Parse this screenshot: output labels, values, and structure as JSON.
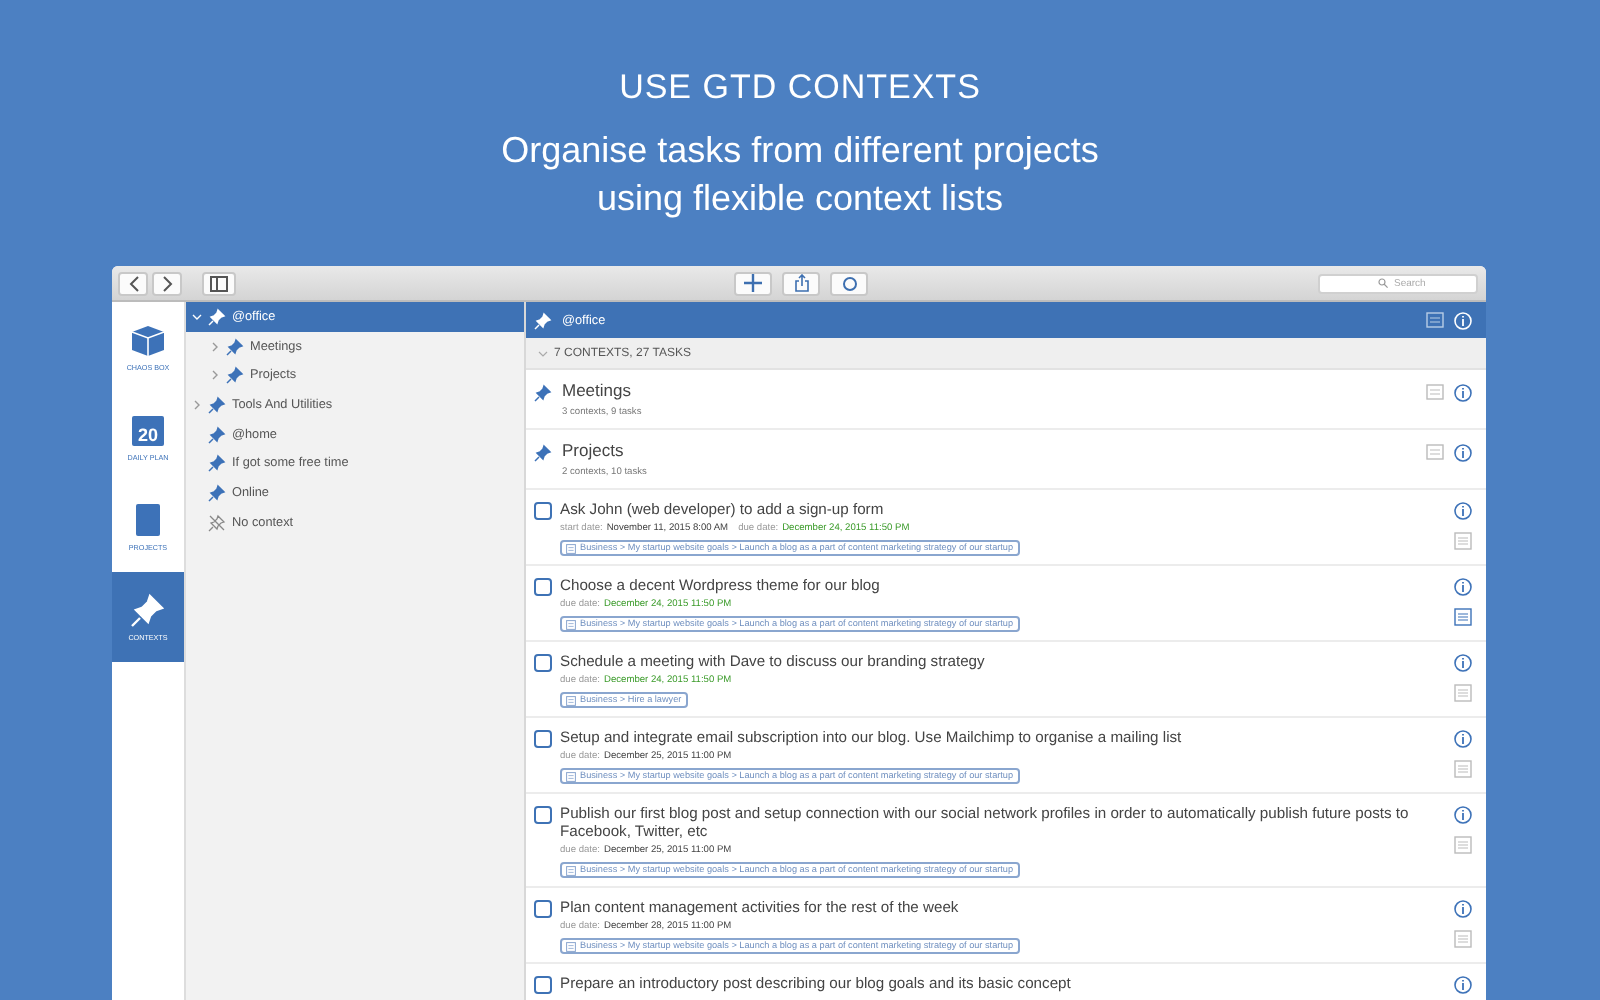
{
  "hero": {
    "title": "USE GTD CONTEXTS",
    "subtitle_lines": [
      "Organise tasks from different projects",
      "using flexible context lists"
    ]
  },
  "toolbar": {
    "search": {
      "placeholder": "Search"
    }
  },
  "nav": [
    {
      "label": "CHAOS BOX",
      "selected": false
    },
    {
      "label": "DAILY PLAN",
      "day": "20",
      "selected": false
    },
    {
      "label": "PROJECTS",
      "selected": false
    },
    {
      "label": "CONTEXTS",
      "selected": true
    }
  ],
  "tree": [
    {
      "label": "@office",
      "kind": "pin",
      "expanded": true,
      "selected": true,
      "children": [
        {
          "label": "Meetings",
          "kind": "pin",
          "expanded": false,
          "selected": false
        },
        {
          "label": "Projects",
          "kind": "pin",
          "expanded": false,
          "selected": false
        }
      ]
    },
    {
      "label": "Tools And Utilities",
      "kind": "pin",
      "expanded": false,
      "selected": false
    },
    {
      "label": "@home",
      "kind": "pin",
      "selected": false
    },
    {
      "label": "If got some free time",
      "kind": "pin",
      "selected": false
    },
    {
      "label": "Online",
      "kind": "pin",
      "selected": false
    },
    {
      "label": "No context",
      "kind": "none",
      "selected": false
    }
  ],
  "main": {
    "header": "@office",
    "group": "7 CONTEXTS, 27 TASKS",
    "contexts": [
      {
        "name": "Meetings",
        "summary": "3 contexts, 9 tasks"
      },
      {
        "name": "Projects",
        "summary": "2 contexts, 10 tasks"
      }
    ],
    "tasks": [
      {
        "title": "Ask John (web developer) to add a sign-up form",
        "checked": false,
        "start_label": "start date:",
        "start": "November 11, 2015 8:00 AM",
        "due_label": "due date:",
        "due": "December 24, 2015 11:50 PM",
        "due_soon": true,
        "project": "Business > My startup website goals > Launch a blog as a part of content marketing strategy of our startup",
        "note_active": false
      },
      {
        "title": "Choose a decent Wordpress theme for our blog",
        "checked": false,
        "due_label": "due date:",
        "due": "December 24, 2015 11:50 PM",
        "due_soon": true,
        "project": "Business > My startup website goals > Launch a blog as a part of content marketing strategy of our startup",
        "note_active": true
      },
      {
        "title": "Schedule a meeting with Dave to discuss our branding strategy",
        "checked": false,
        "due_label": "due date:",
        "due": "December 24, 2015 11:50 PM",
        "due_soon": true,
        "project": "Business > Hire a lawyer",
        "note_active": false
      },
      {
        "title": "Setup and integrate email subscription into our blog. Use Mailchimp to organise a mailing list",
        "checked": false,
        "due_label": "due date:",
        "due": "December 25, 2015 11:00 PM",
        "due_soon": false,
        "project": "Business > My startup website goals > Launch a blog as a part of content marketing strategy of our startup",
        "note_active": false
      },
      {
        "title": "Publish our first blog post and setup connection with our social network profiles in order to automatically publish future posts to Facebook, Twitter, etc",
        "checked": false,
        "due_label": "due date:",
        "due": "December 25, 2015 11:00 PM",
        "due_soon": false,
        "project": "Business > My startup website goals > Launch a blog as a part of content marketing strategy of our startup",
        "note_active": false
      },
      {
        "title": "Plan content management activities for the rest of the week",
        "checked": false,
        "due_label": "due date:",
        "due": "December 28, 2015 11:00 PM",
        "due_soon": false,
        "project": "Business > My startup website goals > Launch a blog as a part of content marketing strategy of our startup",
        "note_active": false
      },
      {
        "title": "Prepare an introductory post describing our blog goals and its basic concept",
        "checked": false
      }
    ]
  }
}
